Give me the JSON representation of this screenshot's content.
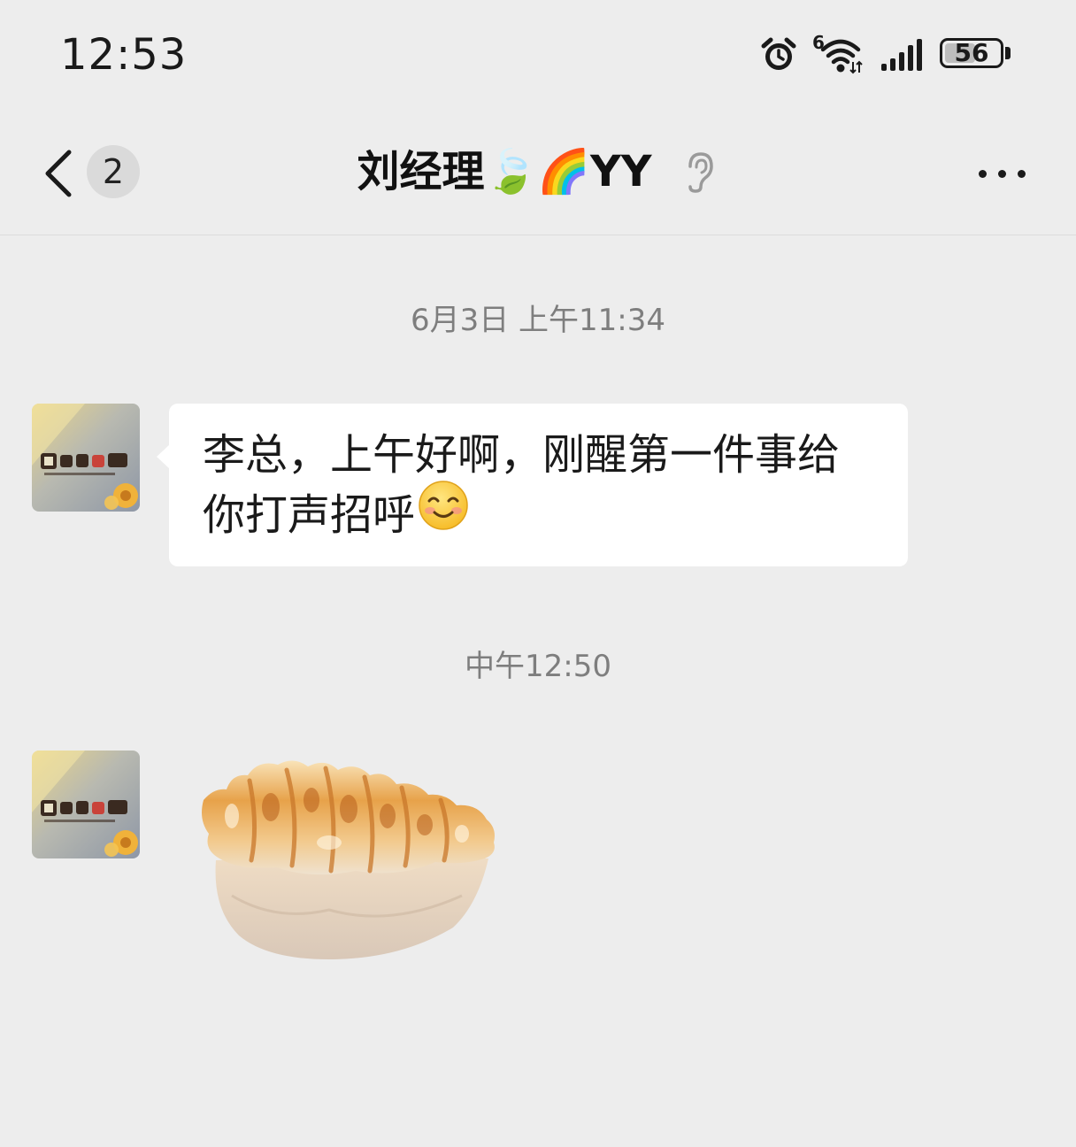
{
  "status_bar": {
    "time": "12:53",
    "wifi_label": "6",
    "battery_level": "56"
  },
  "header": {
    "unread_count": "2",
    "title": "刘经理🍃🌈YY",
    "icons": [
      "back-arrow-icon",
      "ear-icon",
      "more-icon"
    ]
  },
  "messages": [
    {
      "timestamp": "6月3日 上午11:34",
      "type": "text",
      "lines": [
        "李总，上午好啊，刚醒第一件事给",
        "你打声招呼"
      ],
      "emoji": "smiling-face-emoji"
    },
    {
      "timestamp": "中午12:50",
      "type": "sticker",
      "sticker": "fried-dumpling-sticker"
    }
  ],
  "colors": {
    "background": "#ededed",
    "bubble": "#ffffff",
    "timestamp_text": "#7e7e7e",
    "badge": "#dadada"
  }
}
